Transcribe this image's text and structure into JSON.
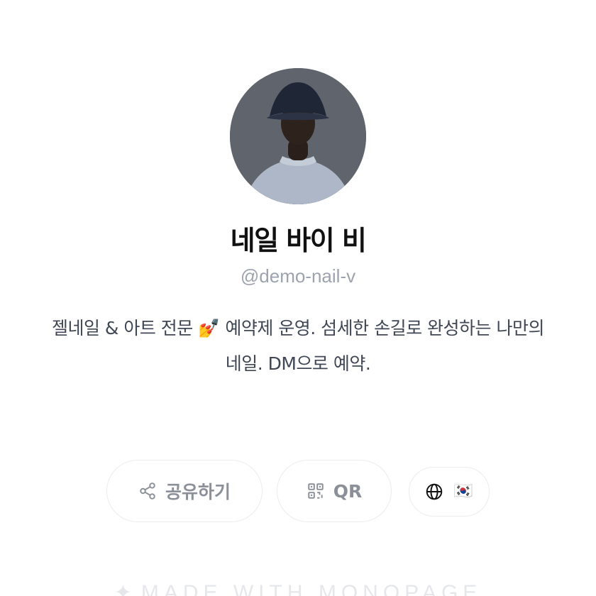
{
  "profile": {
    "name": "네일 바이 비",
    "handle": "@demo-nail-v",
    "bio_line1": "젤네일 & 아트 전문 💅 예약제 운영. 섬세한 손길로 완성하는 나만의",
    "bio_line2": "네일. DM으로 예약.",
    "avatar_icon": "profile-photo"
  },
  "actions": {
    "share_label": "공유하기",
    "share_icon": "share-icon",
    "qr_label": "QR",
    "qr_icon": "qr-code-icon",
    "language_icon": "globe-icon",
    "language_flag": "🇰🇷"
  },
  "footer": {
    "text": "MADE WITH MONOPAGE",
    "icon": "sparkle-icon"
  },
  "colors": {
    "name": "#111111",
    "handle": "#9ca3af",
    "bio": "#3f4654",
    "button_text": "#8a8f98",
    "button_border": "#ececec",
    "footer": "#e5e7eb"
  }
}
